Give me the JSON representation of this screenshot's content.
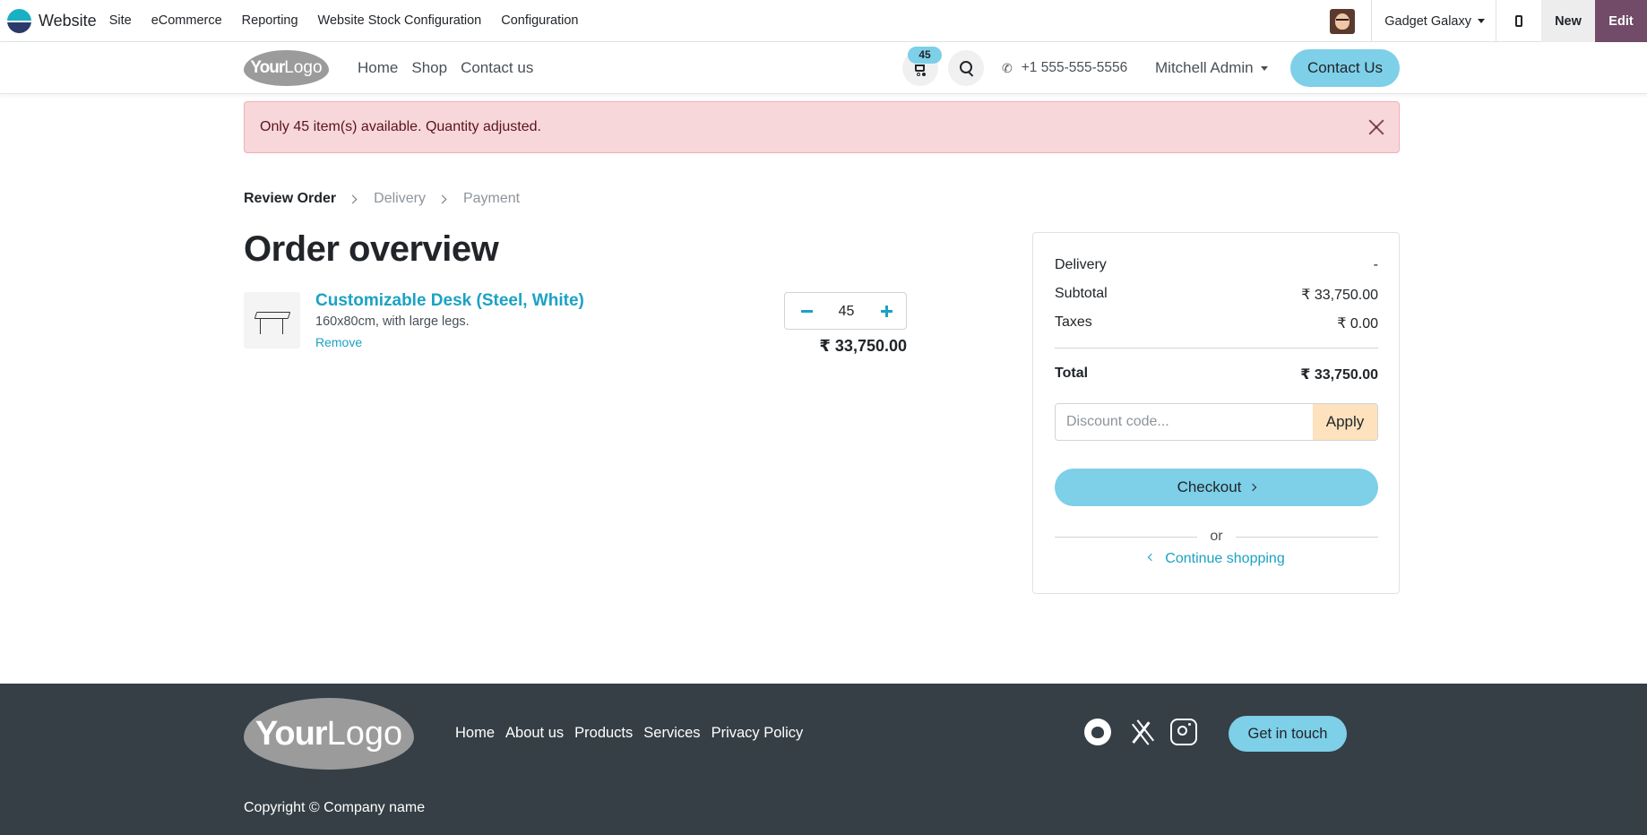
{
  "adminbar": {
    "app_name": "Website",
    "menu": [
      "Site",
      "eCommerce",
      "Reporting",
      "Website Stock Configuration",
      "Configuration"
    ],
    "company": "Gadget Galaxy",
    "new_label": "New",
    "edit_label": "Edit",
    "edit_color": "#714b67"
  },
  "header": {
    "logo_text_bold": "Your",
    "logo_text_light": "Logo",
    "nav": [
      "Home",
      "Shop",
      "Contact us"
    ],
    "cart_count": "45",
    "phone": "+1 555-555-5556",
    "user": "Mitchell Admin",
    "contact_label": "Contact Us",
    "accent_color": "#7ecfe8"
  },
  "alert": {
    "message": "Only 45 item(s) available. Quantity adjusted.",
    "color": "#f8d7da"
  },
  "breadcrumb": {
    "steps": [
      "Review Order",
      "Delivery",
      "Payment"
    ],
    "active_index": 0
  },
  "order": {
    "title": "Order overview",
    "line": {
      "name": "Customizable Desk (Steel, White)",
      "description": "160x80cm, with large legs.",
      "remove_label": "Remove",
      "quantity": "45",
      "price": "₹ 33,750.00"
    }
  },
  "summary": {
    "delivery_label": "Delivery",
    "delivery_value": "-",
    "subtotal_label": "Subtotal",
    "subtotal_value": "₹ 33,750.00",
    "taxes_label": "Taxes",
    "taxes_value": "₹ 0.00",
    "total_label": "Total",
    "total_value": "₹ 33,750.00",
    "discount_placeholder": "Discount code...",
    "apply_label": "Apply",
    "checkout_label": "Checkout",
    "or_label": "or",
    "continue_label": "Continue shopping"
  },
  "footer": {
    "logo_text_bold": "Your",
    "logo_text_light": "Logo",
    "links": [
      "Home",
      "About us",
      "Products",
      "Services",
      "Privacy Policy"
    ],
    "social_icons": [
      "github-icon",
      "x-twitter-icon",
      "instagram-icon"
    ],
    "cta_label": "Get in touch",
    "copyright": "Copyright © Company name",
    "background_color": "#353f45"
  }
}
